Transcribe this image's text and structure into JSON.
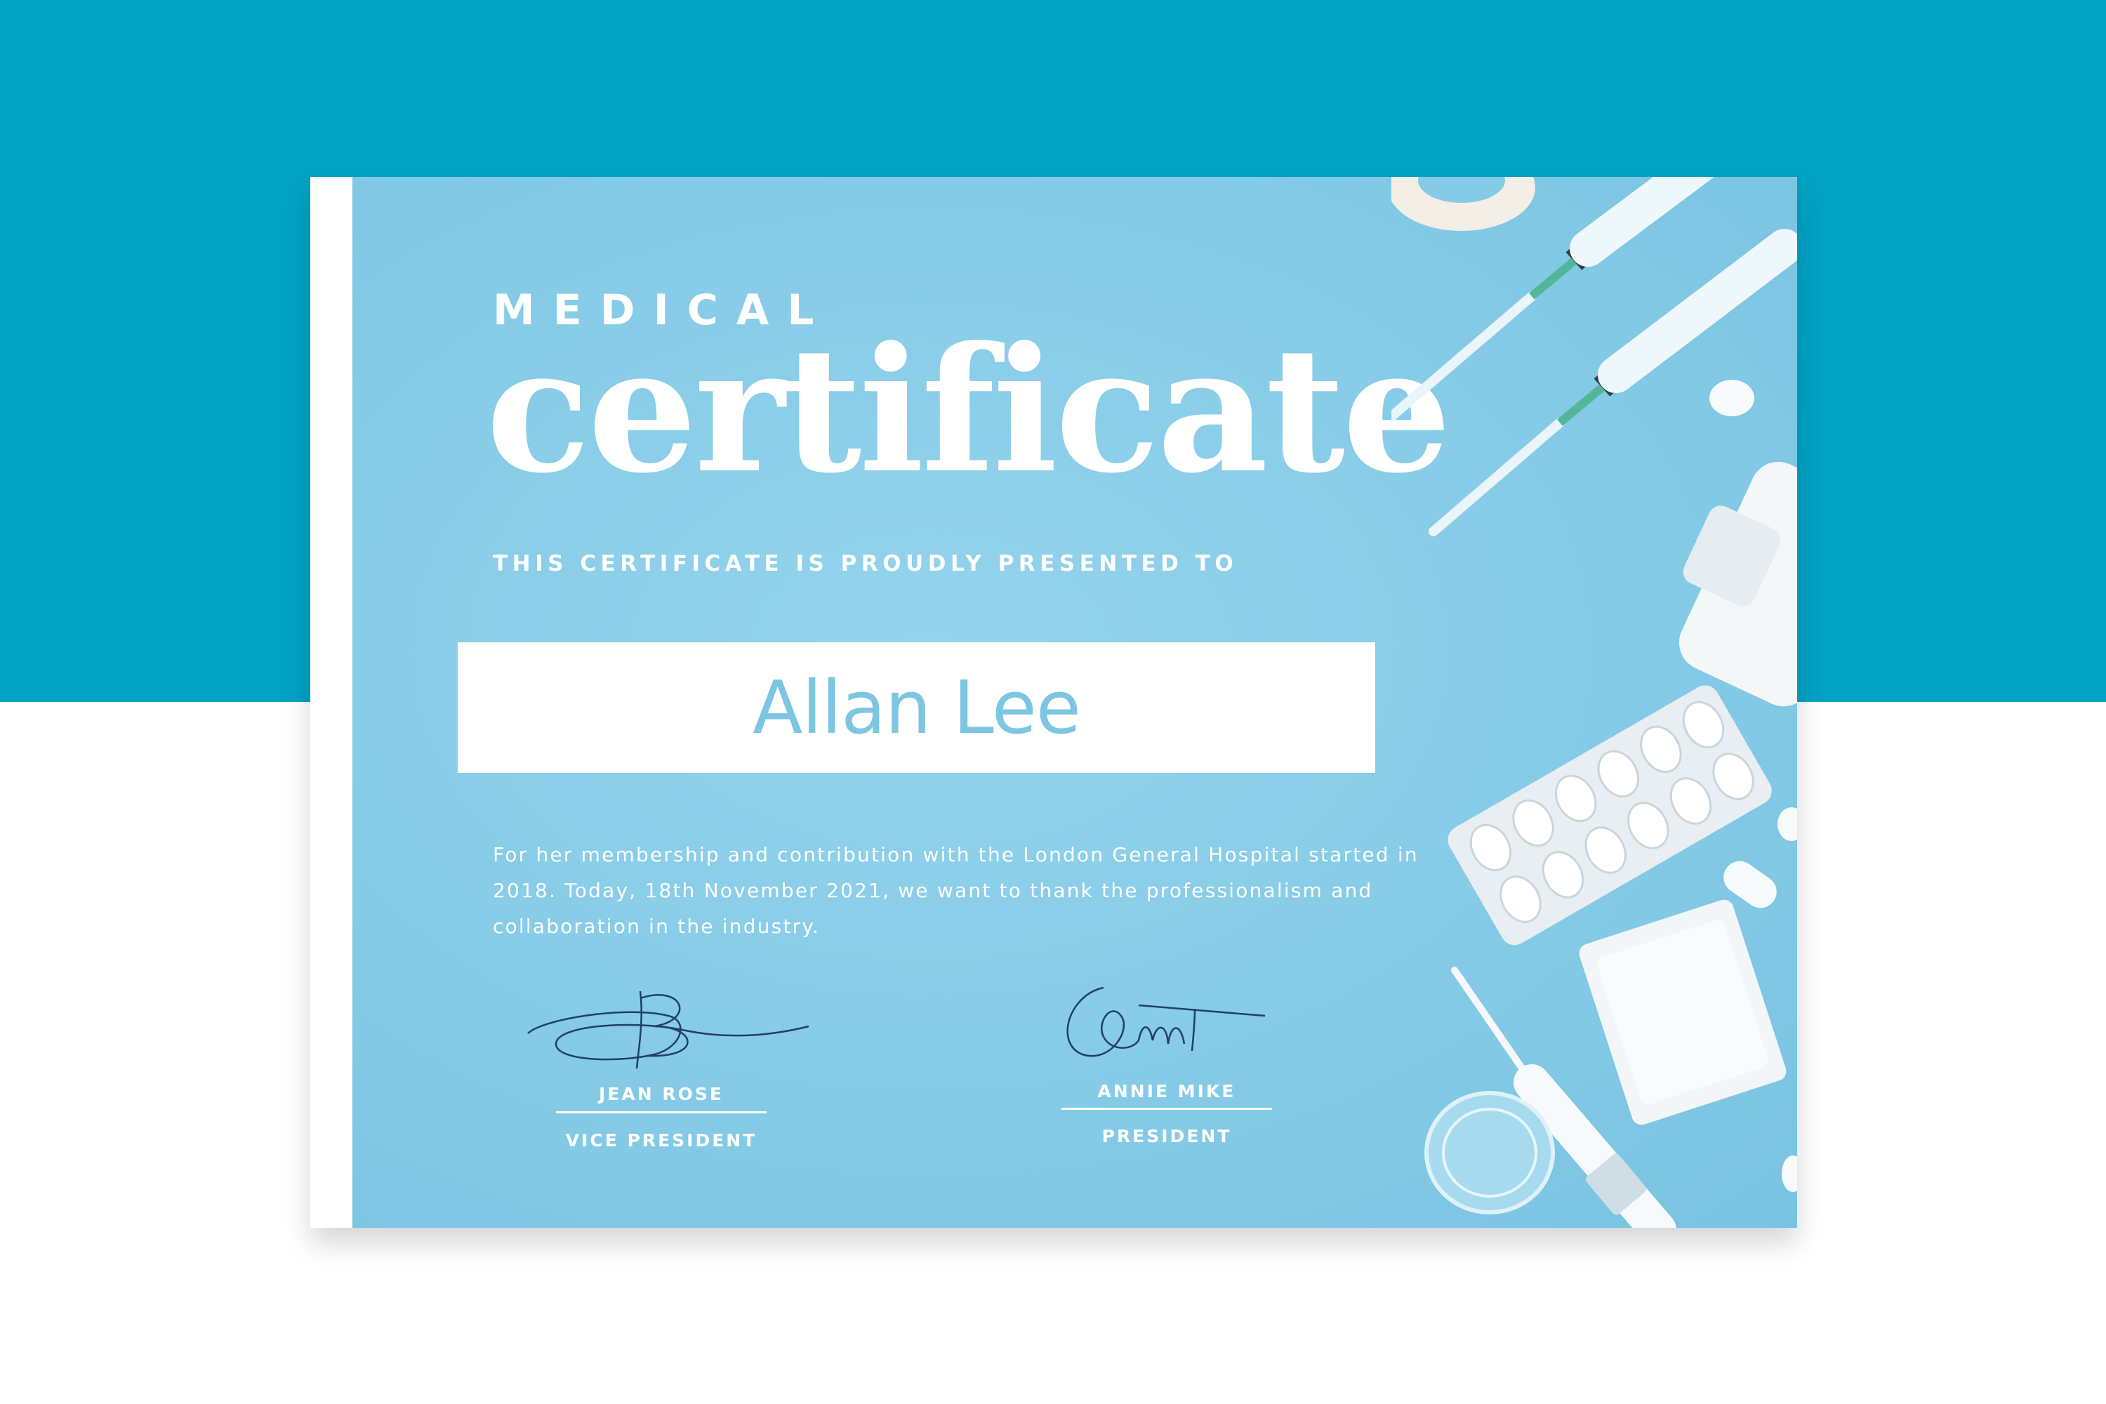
{
  "certificate": {
    "pre_title": "MEDICAL",
    "title": "certificate",
    "presented_to": "THIS CERTIFICATE IS PROUDLY PRESENTED TO",
    "recipient_name": "Allan Lee",
    "body": "For her membership and contribution with the London General Hospital started in 2018.  Today, 18th November 2021, we want to thank the professionalism and collaboration in the industry."
  },
  "signatures": [
    {
      "name": "JEAN ROSE",
      "role": "VICE PRESIDENT"
    },
    {
      "name": "ANNIE MIKE",
      "role": "PRESIDENT"
    }
  ],
  "colors": {
    "band": "#02a2c4",
    "panel": "#85cbe7",
    "name_text": "#7cc6e2"
  },
  "icons": [
    "syringe-icon",
    "tape-roll-icon",
    "pill-bottle-icon",
    "blister-pack-icon",
    "gauze-icon",
    "thermometer-icon",
    "petri-dish-icon",
    "tablet-icon"
  ]
}
